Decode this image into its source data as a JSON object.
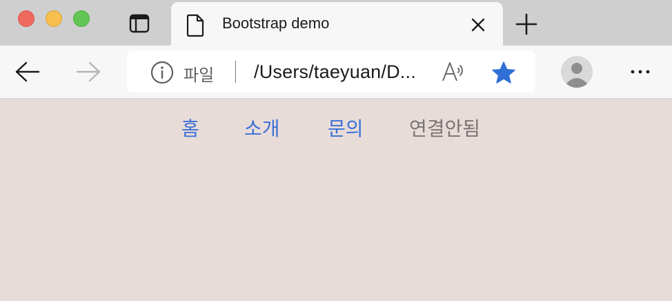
{
  "window": {
    "controls": [
      "close",
      "minimize",
      "maximize"
    ]
  },
  "tab": {
    "title": "Bootstrap demo",
    "favicon": "document-icon"
  },
  "toolbar": {
    "address": {
      "scheme_label": "파일",
      "url": "/Users/taeyuan/D..."
    },
    "favorite_color": "#2f6fd6"
  },
  "page": {
    "background": "#e7dcd8",
    "nav": [
      {
        "label": "홈",
        "state": "active"
      },
      {
        "label": "소개",
        "state": "active"
      },
      {
        "label": "문의",
        "state": "active"
      },
      {
        "label": "연결안됨",
        "state": "disabled"
      }
    ],
    "link_color": "#3b6fd8",
    "disabled_color": "#7b7474"
  }
}
